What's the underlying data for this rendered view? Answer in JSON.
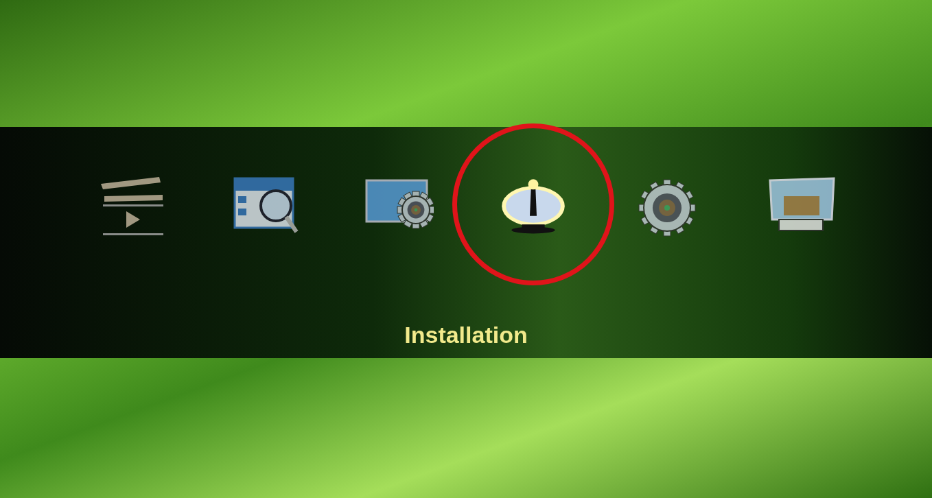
{
  "menu": {
    "items": [
      {
        "kind": "media",
        "selected": false
      },
      {
        "kind": "epg",
        "selected": false
      },
      {
        "kind": "display",
        "selected": false
      },
      {
        "kind": "installation",
        "selected": true,
        "annotated": true
      },
      {
        "kind": "settings",
        "selected": false
      },
      {
        "kind": "storage",
        "selected": false
      }
    ],
    "caption": "Installation"
  }
}
